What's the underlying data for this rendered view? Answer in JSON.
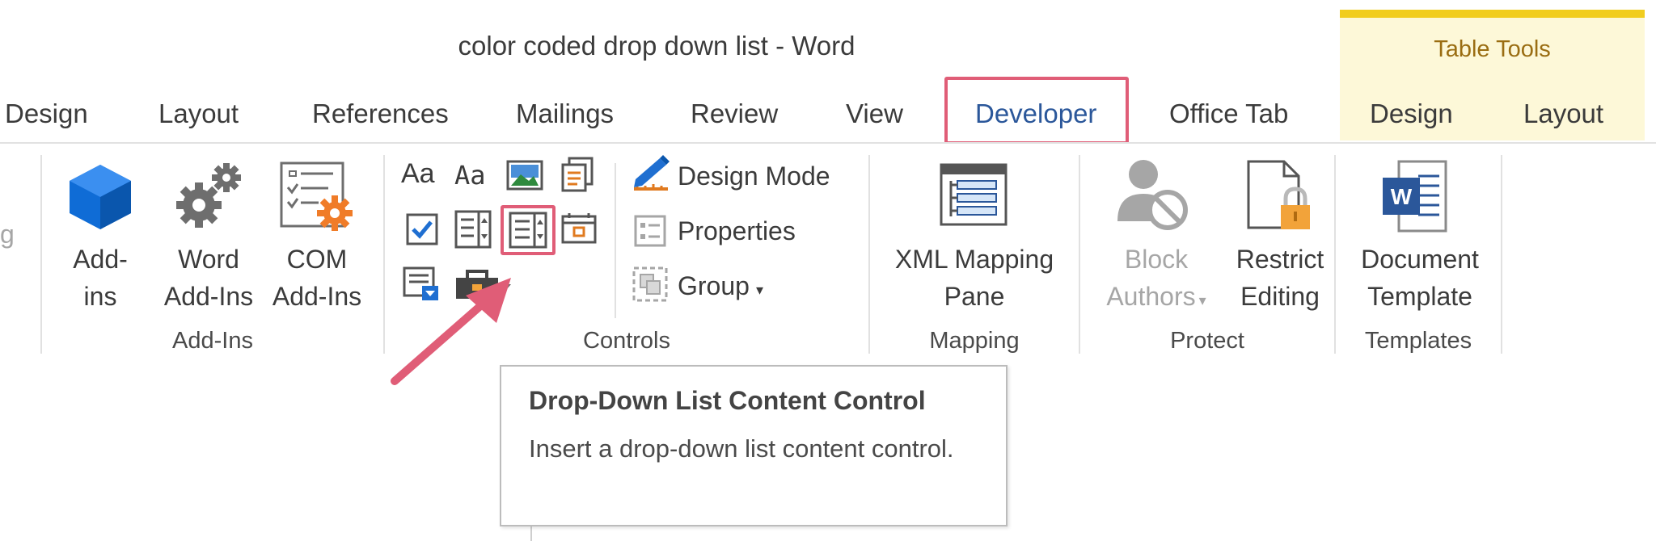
{
  "window": {
    "title": "color coded drop down list - Word"
  },
  "contextual": {
    "label": "Table Tools"
  },
  "tabs": {
    "design": "Design",
    "layout": "Layout",
    "references": "References",
    "mailings": "Mailings",
    "review": "Review",
    "view": "View",
    "developer": "Developer",
    "office_tab": "Office Tab",
    "table_design": "Design",
    "table_layout": "Layout"
  },
  "ribbon": {
    "edge_fragment": "g",
    "addins": {
      "group_label": "Add-Ins",
      "add_ins": [
        "Add-",
        "ins"
      ],
      "word_add_ins": [
        "Word",
        "Add-Ins"
      ],
      "com_add_ins": [
        "COM",
        "Add-Ins"
      ]
    },
    "controls": {
      "group_label": "Controls",
      "rich_text_glyph": "Aa",
      "plain_text_glyph": "Aa",
      "design_mode": "Design Mode",
      "properties": "Properties",
      "group": "Group"
    },
    "mapping": {
      "group_label": "Mapping",
      "xml_mapping_pane": [
        "XML Mapping",
        "Pane"
      ]
    },
    "protect": {
      "group_label": "Protect",
      "block_authors": [
        "Block",
        "Authors"
      ],
      "restrict_editing": [
        "Restrict",
        "Editing"
      ]
    },
    "templates": {
      "group_label": "Templates",
      "document_template": [
        "Document",
        "Template"
      ]
    }
  },
  "tooltip": {
    "title": "Drop-Down List Content Control",
    "description": "Insert a drop-down list content control."
  },
  "colors": {
    "accent": "#2b579a",
    "highlight": "#e05d77",
    "contextual_stripe": "#f1cd1e",
    "addins_blue": "#0f6cd6",
    "lock_orange": "#f2a33a"
  }
}
